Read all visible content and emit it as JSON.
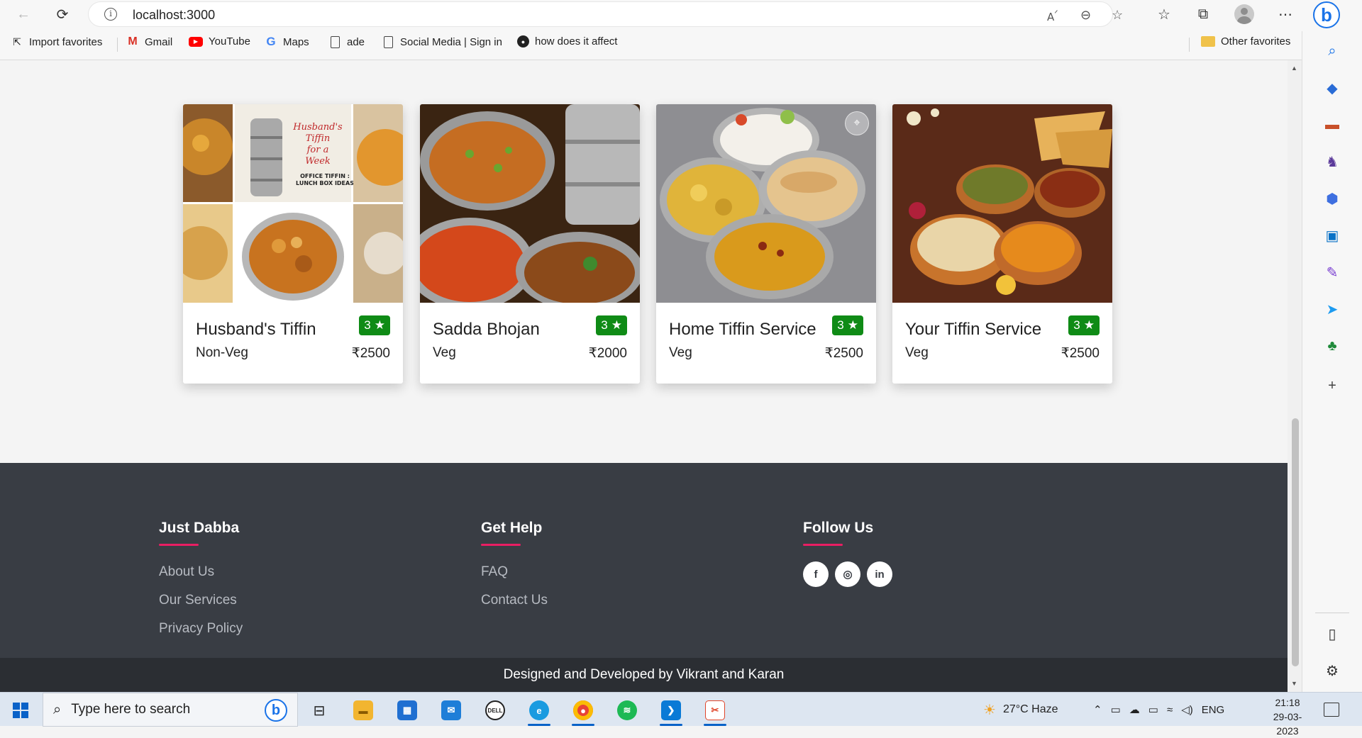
{
  "browser": {
    "url": "localhost:3000",
    "favorites": [
      {
        "label": "Import favorites",
        "icon": "import-icon"
      },
      {
        "label": "Gmail",
        "icon": "gmail-icon"
      },
      {
        "label": "YouTube",
        "icon": "youtube-icon"
      },
      {
        "label": "Maps",
        "icon": "google-icon"
      },
      {
        "label": "ade",
        "icon": "page-icon"
      },
      {
        "label": "Social Media | Sign in",
        "icon": "page-icon"
      },
      {
        "label": "how does it affect",
        "icon": "github-icon"
      }
    ],
    "other_favorites": "Other favorites"
  },
  "cards": [
    {
      "name": "Husband's Tiffin",
      "rating": "3",
      "type": "Non-Veg",
      "price": "₹2500",
      "img_text": [
        "Husband's",
        "Tiffin",
        "for a",
        "Week",
        "OFFICE TIFFIN :",
        "LUNCH BOX IDEAS"
      ]
    },
    {
      "name": "Sadda Bhojan",
      "rating": "3",
      "type": "Veg",
      "price": "₹2000"
    },
    {
      "name": "Home Tiffin Service",
      "rating": "3",
      "type": "Veg",
      "price": "₹2500"
    },
    {
      "name": "Your Tiffin Service",
      "rating": "3",
      "type": "Veg",
      "price": "₹2500"
    }
  ],
  "rating_star": "★",
  "footer": {
    "col1": {
      "title": "Just Dabba",
      "links": [
        "About Us",
        "Our Services",
        "Privacy Policy"
      ]
    },
    "col2": {
      "title": "Get Help",
      "links": [
        "FAQ",
        "Contact Us"
      ]
    },
    "col3": {
      "title": "Follow Us",
      "socials": [
        "facebook-icon",
        "instagram-icon",
        "linkedin-icon"
      ]
    },
    "copyright": "Designed and Developed by Vikrant and Karan"
  },
  "taskbar": {
    "search_placeholder": "Type here to search",
    "weather": "27°C  Haze",
    "language": "ENG",
    "time": "21:18",
    "date": "29-03-2023"
  },
  "colors": {
    "accent_line": "#e91e63",
    "rating_badge": "#0f8b16",
    "footer_bg": "#393d44"
  }
}
